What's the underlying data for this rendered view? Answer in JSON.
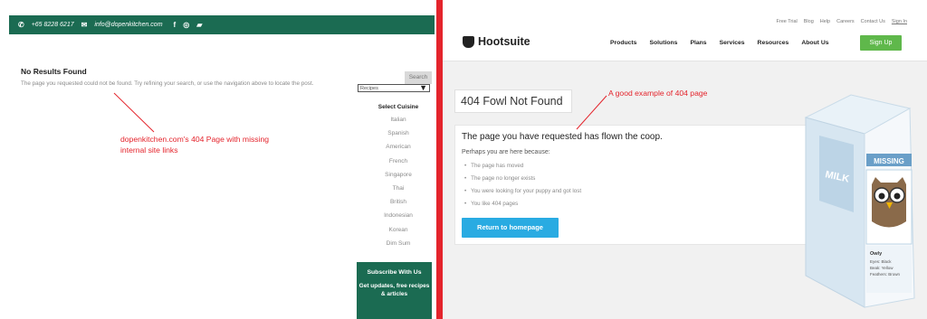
{
  "left": {
    "topbar": {
      "phone": "+65 8228 6217",
      "email": "info@dopenkitchen.com",
      "facebook_glyph": "f"
    },
    "no_results_title": "No Results Found",
    "no_results_text": "The page you requested could not be found. Try refining your search, or use the navigation above to locate the post.",
    "search_label": "Search",
    "select_value": "Recipes",
    "cuisine_title": "Select Cuisine",
    "cuisines": [
      "Italian",
      "Spanish",
      "American",
      "French",
      "Singapore",
      "Thai",
      "British",
      "Indonesian",
      "Korean",
      "Dim Sum"
    ],
    "subscribe_title": "Subscribe With Us",
    "subscribe_text": "Get updates, free recipes & articles",
    "annotation": "dopenkitchen.com's 404 Page with missing internal site links"
  },
  "right": {
    "top_links": [
      "Free Trial",
      "Blog",
      "Help",
      "Careers",
      "Contact Us",
      "Sign In"
    ],
    "logo_text": "Hootsuite",
    "nav": [
      "Products",
      "Solutions",
      "Plans",
      "Services",
      "Resources",
      "About Us"
    ],
    "signup": "Sign Up",
    "title404": "404 Fowl Not Found",
    "card_heading": "The page you have requested has flown the coop.",
    "card_sub": "Perhaps you are here because:",
    "reasons": [
      "The page has moved",
      "The page no longer exists",
      "You were looking for your puppy and got lost",
      "You like 404 pages"
    ],
    "return_button": "Return to homepage",
    "annotation": "A good example of 404 page",
    "carton": {
      "milk": "MILK",
      "missing": "MISSING",
      "owl_name": "Owly",
      "owl_details": [
        "Eyes: Black",
        "Beak: Yellow",
        "Feathers: Brown"
      ]
    }
  },
  "colors": {
    "accent_red": "#e4242c",
    "dopen_green": "#1b6b52",
    "hootsuite_green": "#5fb84b",
    "button_blue": "#29abe2"
  }
}
